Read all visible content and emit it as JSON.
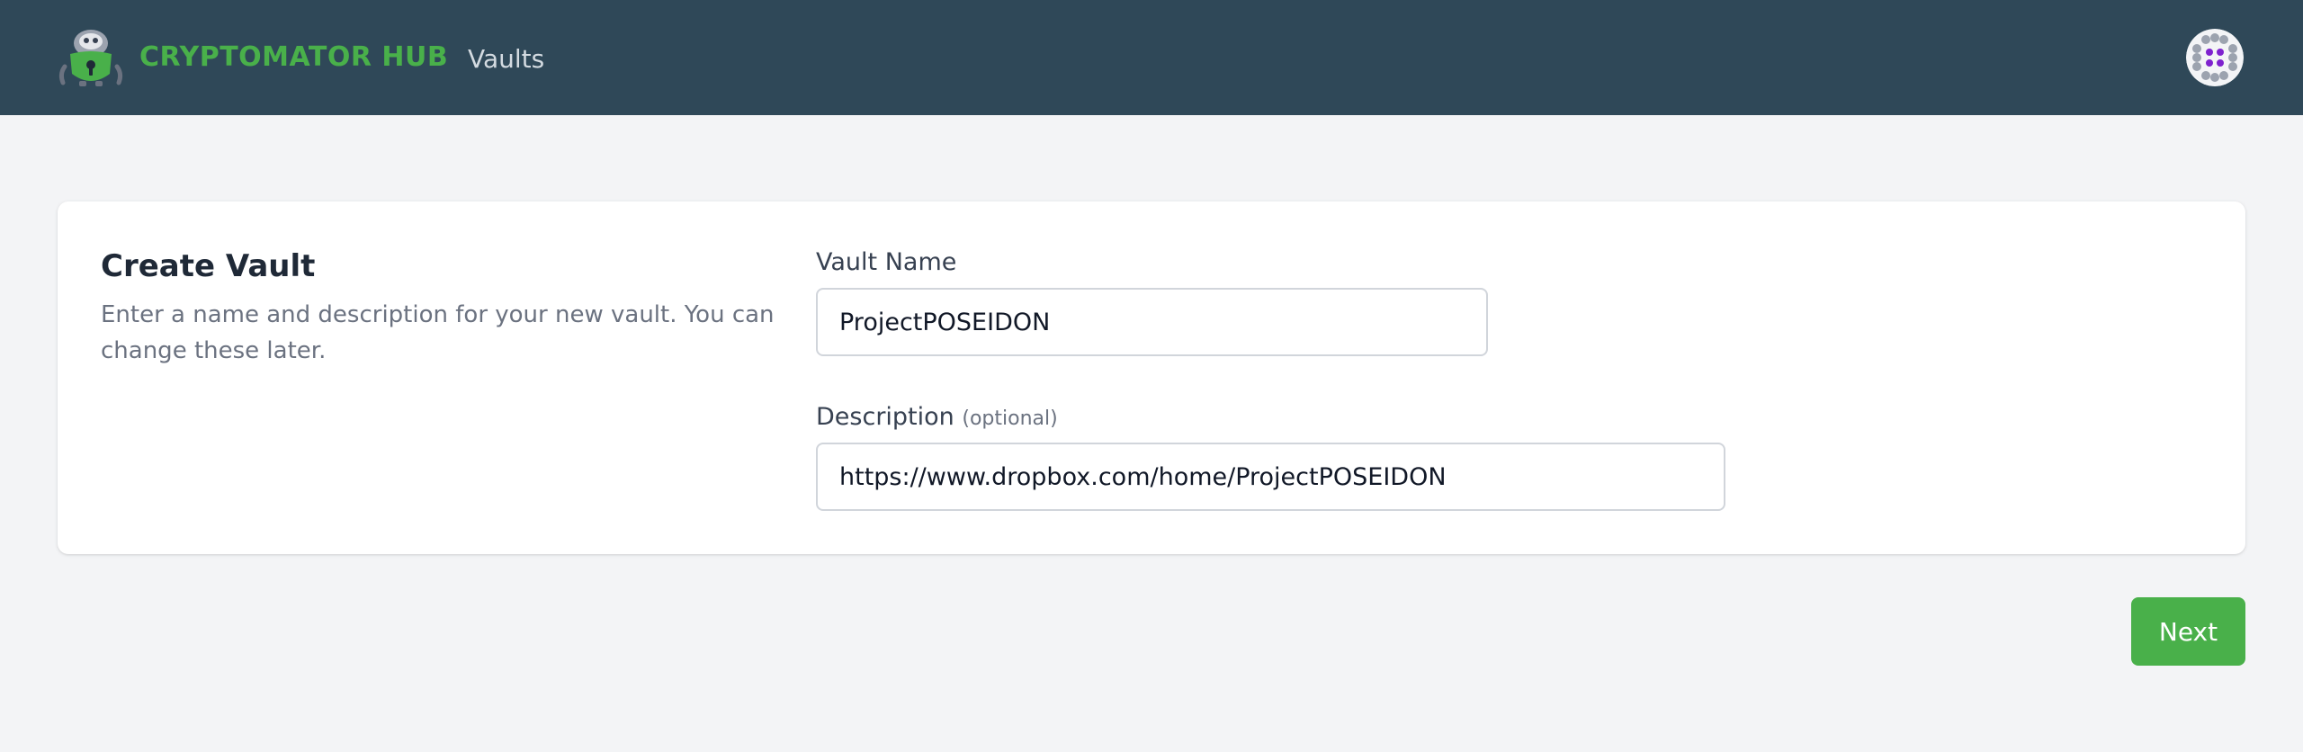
{
  "header": {
    "brand": "CRYPTOMATOR HUB",
    "nav_items": [
      {
        "label": "Vaults"
      }
    ],
    "colors": {
      "navbar_bg": "#2f4858",
      "brand": "#49b04a"
    }
  },
  "form": {
    "title": "Create Vault",
    "description": "Enter a name and description for your new vault. You can change these later.",
    "fields": {
      "vault_name": {
        "label": "Vault Name",
        "value": "ProjectPOSEIDON"
      },
      "description": {
        "label": "Description",
        "optional_hint": "(optional)",
        "value": "https://www.dropbox.com/home/ProjectPOSEIDON"
      }
    }
  },
  "actions": {
    "next_label": "Next",
    "accent_color": "#49b04a"
  },
  "icons": {
    "logo": "cryptomator-robot-icon",
    "avatar": "user-avatar-icon"
  }
}
